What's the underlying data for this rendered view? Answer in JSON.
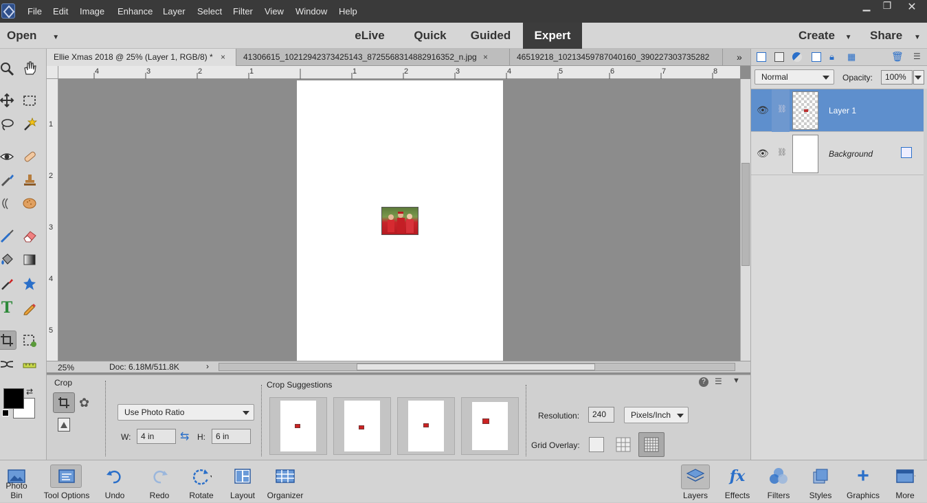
{
  "menubar": {
    "items": [
      "File",
      "Edit",
      "Image",
      "Enhance",
      "Layer",
      "Select",
      "Filter",
      "View",
      "Window",
      "Help"
    ]
  },
  "modebar": {
    "open_label": "Open",
    "tabs": [
      "eLive",
      "Quick",
      "Guided",
      "Expert"
    ],
    "active_tab": "Expert",
    "create_label": "Create",
    "share_label": "Share"
  },
  "document_tabs": [
    {
      "title": "Ellie Xmas 2018 @ 25% (Layer 1, RGB/8) *",
      "close": "×"
    },
    {
      "title": "41306615_10212942373425143_8725568314882916352_n.jpg",
      "close": "×"
    },
    {
      "title": "46519218_10213459787040160_390227303735282",
      "close": ""
    }
  ],
  "tabs_overflow": "»",
  "rulers": {
    "h_labels": [
      "4",
      "3",
      "2",
      "1",
      "1",
      "2",
      "3",
      "4",
      "5",
      "6",
      "7",
      "8"
    ],
    "v_labels": [
      "1",
      "2",
      "3",
      "4",
      "5"
    ]
  },
  "status": {
    "zoom": "25%",
    "doc_info": "Doc: 6.18M/511.8K",
    "arrow": "›"
  },
  "tool_options": {
    "tool_name": "Crop",
    "ratio_select": "Use Photo Ratio",
    "w_label": "W:",
    "w_value": "4 in",
    "h_label": "H:",
    "h_value": "6 in",
    "suggestions_title": "Crop Suggestions",
    "resolution_label": "Resolution:",
    "resolution_value": "240",
    "resolution_unit": "Pixels/Inch",
    "grid_overlay_label": "Grid Overlay:",
    "help": "?"
  },
  "layers_panel": {
    "blend_mode": "Normal",
    "opacity_label": "Opacity:",
    "opacity_value": "100%",
    "layers": [
      {
        "name": "Layer 1",
        "selected": true,
        "visible": true
      },
      {
        "name": "Background",
        "selected": false,
        "visible": true
      }
    ]
  },
  "bottom_left": [
    {
      "label": "Photo Bin",
      "icon": "photo-bin-icon"
    },
    {
      "label": "Tool Options",
      "icon": "tool-options-icon"
    },
    {
      "label": "Undo",
      "icon": "undo-icon"
    },
    {
      "label": "Redo",
      "icon": "redo-icon"
    },
    {
      "label": "Rotate",
      "icon": "rotate-icon"
    },
    {
      "label": "Layout",
      "icon": "layout-icon"
    },
    {
      "label": "Organizer",
      "icon": "organizer-icon"
    }
  ],
  "bottom_right": [
    {
      "label": "Layers",
      "icon": "layers-icon"
    },
    {
      "label": "Effects",
      "icon": "fx-icon"
    },
    {
      "label": "Filters",
      "icon": "filters-icon"
    },
    {
      "label": "Styles",
      "icon": "styles-icon"
    },
    {
      "label": "Graphics",
      "icon": "graphics-plus-icon"
    },
    {
      "label": "More",
      "icon": "more-icon"
    }
  ],
  "colors": {
    "accent_blue": "#5e8fcd",
    "menubar_bg": "#3a3a3a",
    "canvas_bg": "#8c8c8c"
  }
}
